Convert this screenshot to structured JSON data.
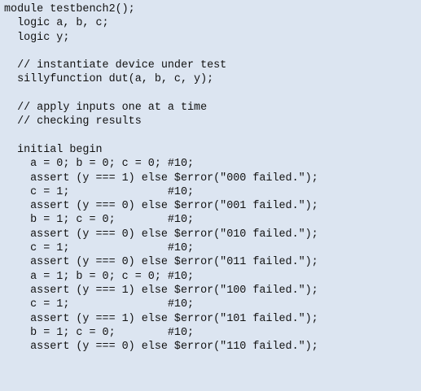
{
  "code": {
    "lines": [
      "module testbench2();",
      "  logic a, b, c;",
      "  logic y;",
      "",
      "  // instantiate device under test",
      "  sillyfunction dut(a, b, c, y);",
      "",
      "  // apply inputs one at a time",
      "  // checking results",
      "",
      "  initial begin",
      "    a = 0; b = 0; c = 0; #10;",
      "    assert (y === 1) else $error(\"000 failed.\");",
      "    c = 1;               #10;",
      "    assert (y === 0) else $error(\"001 failed.\");",
      "    b = 1; c = 0;        #10;",
      "    assert (y === 0) else $error(\"010 failed.\");",
      "    c = 1;               #10;",
      "    assert (y === 0) else $error(\"011 failed.\");",
      "    a = 1; b = 0; c = 0; #10;",
      "    assert (y === 1) else $error(\"100 failed.\");",
      "    c = 1;               #10;",
      "    assert (y === 1) else $error(\"101 failed.\");",
      "    b = 1; c = 0;        #10;",
      "    assert (y === 0) else $error(\"110 failed.\");"
    ]
  }
}
